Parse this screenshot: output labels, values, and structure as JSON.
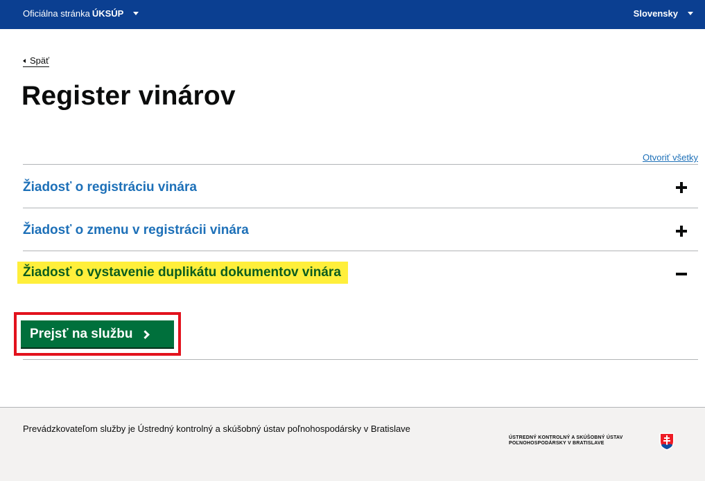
{
  "topbar": {
    "official_prefix": "Oficiálna stránka",
    "official_brand": "ÚKSÚP",
    "language": "Slovensky"
  },
  "back_label": "Späť",
  "page_title": "Register vinárov",
  "open_all_label": "Otvoriť všetky",
  "accordion": [
    {
      "label": "Žiadosť o registráciu vinára",
      "expanded": false
    },
    {
      "label": "Žiadosť o zmenu v registrácii vinára",
      "expanded": false
    },
    {
      "label": "Žiadosť o vystavenie duplikátu dokumentov vinára",
      "expanded": true
    }
  ],
  "cta_label": "Prejsť na službu",
  "footer": {
    "operator_text": "Prevádzkovateľom služby je Ústredný kontrolný a skúšobný ústav poľnohospodársky v Bratislave",
    "org_line1": "ÚSTREDNÝ KONTROLNÝ A SKÚŠOBNÝ ÚSTAV",
    "org_line2": "POĽNOHOSPODÁRSKY V BRATISLAVE"
  },
  "colors": {
    "topbar": "#0b3f91",
    "link": "#1d70b8",
    "highlight": "#ffef3b",
    "button": "#00703c",
    "focus_outline": "#e2121d",
    "footer_bg": "#f3f2f1"
  }
}
